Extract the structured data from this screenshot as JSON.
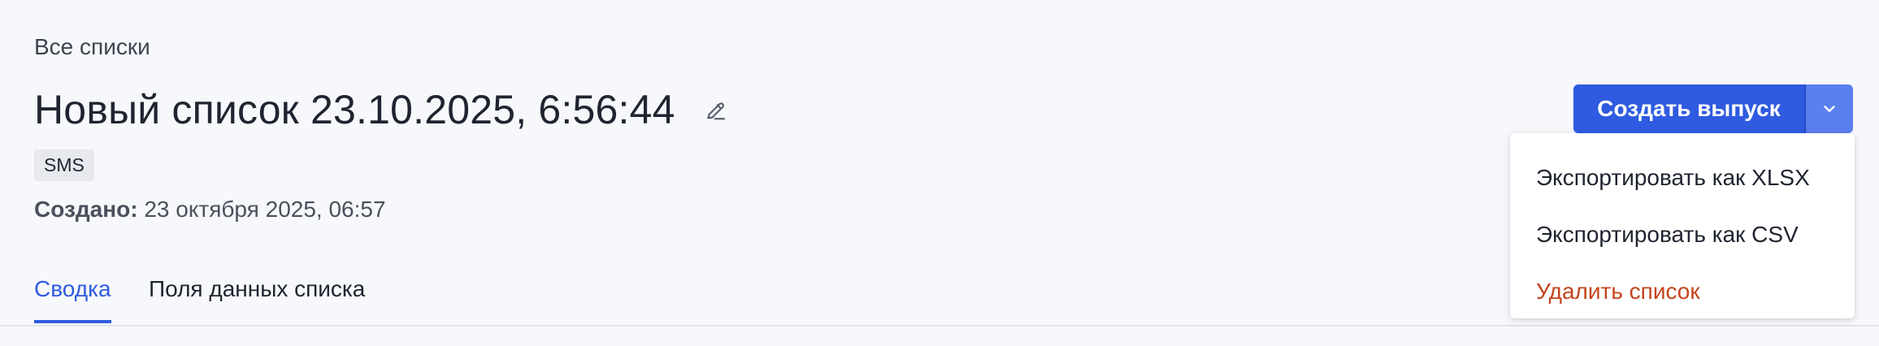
{
  "breadcrumb": {
    "label": "Все списки"
  },
  "header": {
    "title": "Новый список 23.10.2025, 6:56:44",
    "channel_badge": "SMS",
    "created_label": "Создано:",
    "created_value": " 23 октября 2025, 06:57",
    "edit_icon": "pencil-icon"
  },
  "tabs": [
    {
      "label": "Сводка",
      "active": true
    },
    {
      "label": "Поля данных списка",
      "active": false
    }
  ],
  "actions": {
    "primary_label": "Создать выпуск",
    "caret_icon": "chevron-down-icon",
    "menu": [
      {
        "label": "Экспортировать как XLSX"
      },
      {
        "label": "Экспортировать как CSV"
      },
      {
        "label": "Удалить список",
        "danger": true
      }
    ]
  },
  "colors": {
    "accent": "#2f5be0",
    "accent_light": "#5a7fee",
    "danger": "#c4441d",
    "background": "#f7f8fb"
  }
}
